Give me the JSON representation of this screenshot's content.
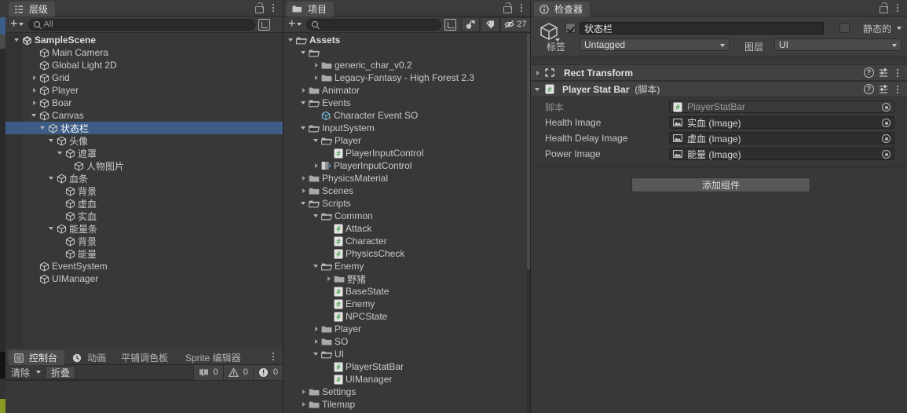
{
  "hierarchy": {
    "tab_label": "层级",
    "tab_icon": "hierarchy-icon",
    "search_placeholder": "All",
    "add_label": "+",
    "items": [
      {
        "label": "SampleScene",
        "depth": 0,
        "icon": "unity-scene-icon",
        "arrow": "open",
        "selected": false,
        "bold": true
      },
      {
        "label": "Main Camera",
        "depth": 2,
        "icon": "gameobject-cube-icon",
        "arrow": "none",
        "selected": false,
        "bold": false
      },
      {
        "label": "Global Light 2D",
        "depth": 2,
        "icon": "gameobject-cube-icon",
        "arrow": "none",
        "selected": false,
        "bold": false
      },
      {
        "label": "Grid",
        "depth": 2,
        "icon": "gameobject-cube-icon",
        "arrow": "closed",
        "selected": false,
        "bold": false
      },
      {
        "label": "Player",
        "depth": 2,
        "icon": "gameobject-cube-icon",
        "arrow": "closed",
        "selected": false,
        "bold": false
      },
      {
        "label": "Boar",
        "depth": 2,
        "icon": "gameobject-cube-icon",
        "arrow": "closed",
        "selected": false,
        "bold": false
      },
      {
        "label": "Canvas",
        "depth": 2,
        "icon": "gameobject-cube-icon",
        "arrow": "open",
        "selected": false,
        "bold": false
      },
      {
        "label": "状态栏",
        "depth": 3,
        "icon": "gameobject-cube-icon",
        "arrow": "open",
        "selected": true,
        "bold": false
      },
      {
        "label": "头像",
        "depth": 4,
        "icon": "gameobject-cube-icon",
        "arrow": "open",
        "selected": false,
        "bold": false
      },
      {
        "label": "遮罩",
        "depth": 5,
        "icon": "gameobject-cube-icon",
        "arrow": "open",
        "selected": false,
        "bold": false
      },
      {
        "label": "人物图片",
        "depth": 6,
        "icon": "gameobject-cube-icon",
        "arrow": "none",
        "selected": false,
        "bold": false
      },
      {
        "label": "血条",
        "depth": 4,
        "icon": "gameobject-cube-icon",
        "arrow": "open",
        "selected": false,
        "bold": false
      },
      {
        "label": "背景",
        "depth": 5,
        "icon": "gameobject-cube-icon",
        "arrow": "none",
        "selected": false,
        "bold": false
      },
      {
        "label": "虚血",
        "depth": 5,
        "icon": "gameobject-cube-icon",
        "arrow": "none",
        "selected": false,
        "bold": false
      },
      {
        "label": "实血",
        "depth": 5,
        "icon": "gameobject-cube-icon",
        "arrow": "none",
        "selected": false,
        "bold": false
      },
      {
        "label": "能量条",
        "depth": 4,
        "icon": "gameobject-cube-icon",
        "arrow": "open",
        "selected": false,
        "bold": false
      },
      {
        "label": "背景",
        "depth": 5,
        "icon": "gameobject-cube-icon",
        "arrow": "none",
        "selected": false,
        "bold": false
      },
      {
        "label": "能量",
        "depth": 5,
        "icon": "gameobject-cube-icon",
        "arrow": "none",
        "selected": false,
        "bold": false
      },
      {
        "label": "EventSystem",
        "depth": 2,
        "icon": "gameobject-cube-icon",
        "arrow": "none",
        "selected": false,
        "bold": false
      },
      {
        "label": "UIManager",
        "depth": 2,
        "icon": "gameobject-cube-icon",
        "arrow": "none",
        "selected": false,
        "bold": false
      }
    ]
  },
  "console": {
    "tabs": [
      {
        "label": "控制台",
        "icon": "console-icon",
        "active": true
      },
      {
        "label": "动画",
        "icon": "animation-clock-icon",
        "active": false
      },
      {
        "label": "平铺调色板",
        "icon": "none",
        "active": false
      },
      {
        "label": "Sprite 编辑器",
        "icon": "none",
        "active": false
      }
    ],
    "clear_label": "清除",
    "collapse_label": "折叠",
    "counters": [
      {
        "icon": "log-message-icon",
        "value": "0"
      },
      {
        "icon": "warning-triangle-icon",
        "value": "0"
      },
      {
        "icon": "error-circle-icon",
        "value": "0"
      }
    ]
  },
  "project": {
    "tab_label": "项目",
    "tab_icon": "folder-icon",
    "search_placeholder": "",
    "add_label": "+",
    "toolbar_icons": [
      "asset-pipeline-icon",
      "label-tag-icon",
      "hidden-packages-icon"
    ],
    "hidden_count": "27",
    "items": [
      {
        "label": "Assets",
        "depth": 0,
        "icon": "folder-open-icon",
        "arrow": "open",
        "bold": true
      },
      {
        "label": "",
        "depth": 1,
        "icon": "folder-open-icon",
        "arrow": "open",
        "bold": false
      },
      {
        "label": "generic_char_v0.2",
        "depth": 2,
        "icon": "folder-icon",
        "arrow": "closed",
        "bold": false
      },
      {
        "label": "Legacy-Fantasy - High Forest 2.3",
        "depth": 2,
        "icon": "folder-icon",
        "arrow": "closed",
        "bold": false
      },
      {
        "label": "Animator",
        "depth": 1,
        "icon": "folder-icon",
        "arrow": "closed",
        "bold": false
      },
      {
        "label": "Events",
        "depth": 1,
        "icon": "folder-open-icon",
        "arrow": "open",
        "bold": false
      },
      {
        "label": "Character Event SO",
        "depth": 2,
        "icon": "scriptable-object-icon",
        "arrow": "none",
        "bold": false
      },
      {
        "label": "InputSystem",
        "depth": 1,
        "icon": "folder-open-icon",
        "arrow": "open",
        "bold": false
      },
      {
        "label": "Player",
        "depth": 2,
        "icon": "folder-open-icon",
        "arrow": "open",
        "bold": false
      },
      {
        "label": "PlayerInputControl",
        "depth": 3,
        "icon": "cs-script-icon",
        "arrow": "none",
        "bold": false
      },
      {
        "label": "PlayerInputControl",
        "depth": 2,
        "icon": "input-actions-icon",
        "arrow": "closed",
        "bold": false
      },
      {
        "label": "PhysicsMaterial",
        "depth": 1,
        "icon": "folder-icon",
        "arrow": "closed",
        "bold": false
      },
      {
        "label": "Scenes",
        "depth": 1,
        "icon": "folder-icon",
        "arrow": "closed",
        "bold": false
      },
      {
        "label": "Scripts",
        "depth": 1,
        "icon": "folder-open-icon",
        "arrow": "open",
        "bold": false
      },
      {
        "label": "Common",
        "depth": 2,
        "icon": "folder-open-icon",
        "arrow": "open",
        "bold": false
      },
      {
        "label": "Attack",
        "depth": 3,
        "icon": "cs-script-icon",
        "arrow": "none",
        "bold": false
      },
      {
        "label": "Character",
        "depth": 3,
        "icon": "cs-script-icon",
        "arrow": "none",
        "bold": false
      },
      {
        "label": "PhysicsCheck",
        "depth": 3,
        "icon": "cs-script-icon",
        "arrow": "none",
        "bold": false
      },
      {
        "label": "Enemy",
        "depth": 2,
        "icon": "folder-open-icon",
        "arrow": "open",
        "bold": false
      },
      {
        "label": "野猪",
        "depth": 3,
        "icon": "folder-icon",
        "arrow": "closed",
        "bold": false
      },
      {
        "label": "BaseState",
        "depth": 3,
        "icon": "cs-script-icon",
        "arrow": "none",
        "bold": false
      },
      {
        "label": "Enemy",
        "depth": 3,
        "icon": "cs-script-icon",
        "arrow": "none",
        "bold": false
      },
      {
        "label": "NPCState",
        "depth": 3,
        "icon": "cs-script-icon",
        "arrow": "none",
        "bold": false
      },
      {
        "label": "Player",
        "depth": 2,
        "icon": "folder-icon",
        "arrow": "closed",
        "bold": false
      },
      {
        "label": "SO",
        "depth": 2,
        "icon": "folder-icon",
        "arrow": "closed",
        "bold": false
      },
      {
        "label": "UI",
        "depth": 2,
        "icon": "folder-open-icon",
        "arrow": "open",
        "bold": false
      },
      {
        "label": "PlayerStatBar",
        "depth": 3,
        "icon": "cs-script-icon",
        "arrow": "none",
        "bold": false
      },
      {
        "label": "UIManager",
        "depth": 3,
        "icon": "cs-script-icon",
        "arrow": "none",
        "bold": false
      },
      {
        "label": "Settings",
        "depth": 1,
        "icon": "folder-icon",
        "arrow": "closed",
        "bold": false
      },
      {
        "label": "Tilemap",
        "depth": 1,
        "icon": "folder-icon",
        "arrow": "closed",
        "bold": false
      }
    ]
  },
  "inspector": {
    "tab_label": "检查器",
    "tab_icon": "info-icon",
    "object_name": "状态栏",
    "object_enabled": true,
    "static_label": "静态的",
    "static_checked": false,
    "tag_label": "标签",
    "tag_value": "Untagged",
    "layer_label": "图层",
    "layer_value": "UI",
    "components": [
      {
        "title": "Rect Transform",
        "subtitle": "",
        "icon": "rect-transform-icon",
        "expanded": false
      },
      {
        "title": "Player Stat Bar",
        "subtitle": "(脚本)",
        "icon": "cs-script-icon",
        "expanded": true
      }
    ],
    "properties": [
      {
        "label": "脚本",
        "value": "PlayerStatBar",
        "icon": "cs-script-icon",
        "dimmed": true
      },
      {
        "label": "Health Image",
        "value": "实血 (Image)",
        "icon": "image-component-icon",
        "dimmed": false
      },
      {
        "label": "Health Delay Image",
        "value": "虚血 (Image)",
        "icon": "image-component-icon",
        "dimmed": false
      },
      {
        "label": "Power Image",
        "value": "能量 (Image)",
        "icon": "image-component-icon",
        "dimmed": false
      }
    ],
    "add_component_label": "添加组件"
  },
  "annotation": {
    "arrow_color": "#f71b1b",
    "arrow_name": "red-pointer-arrow"
  },
  "colors": {
    "panel_bg": "#383838",
    "tab_bg": "#3c3c3c",
    "selection_blue": "#3d5c85",
    "text": "#c8c8c8",
    "folder": "#a8a8a8",
    "script_green": "#4caf50"
  }
}
